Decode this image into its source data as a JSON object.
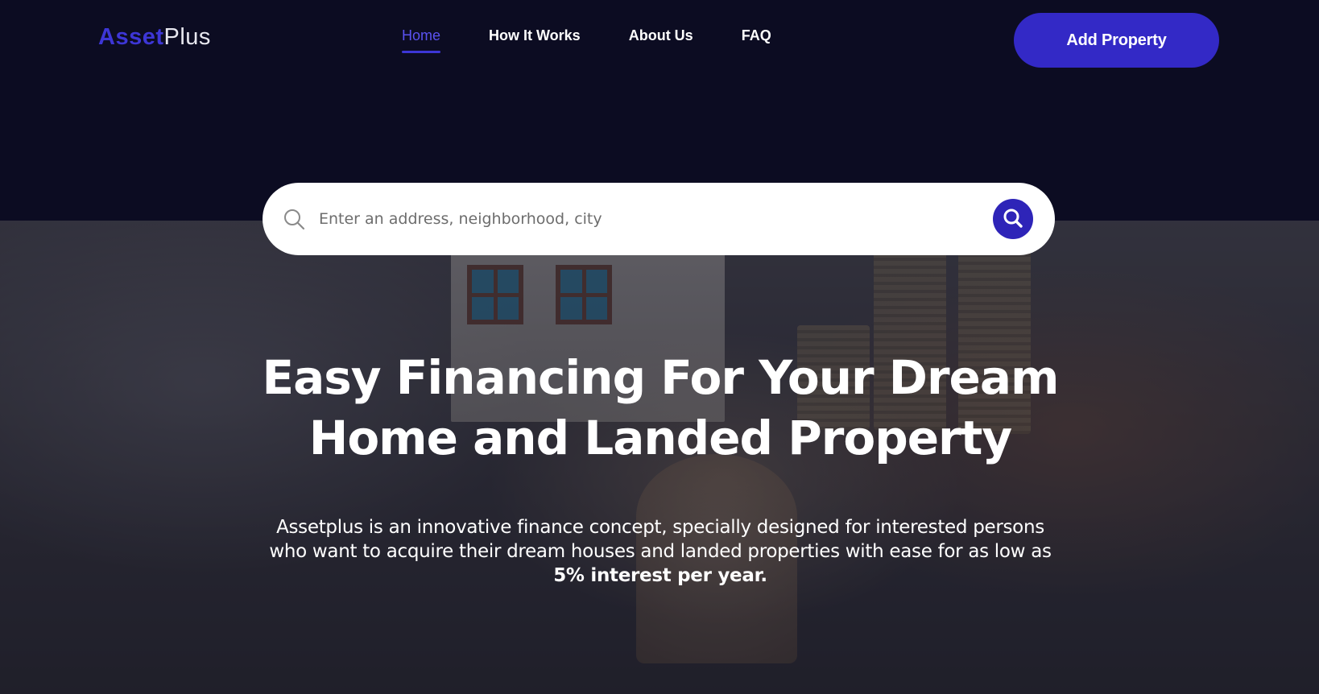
{
  "header": {
    "logo_part1": "Asset",
    "logo_part2": "Plus",
    "nav": [
      {
        "label": "Home",
        "active": true
      },
      {
        "label": "How It Works",
        "active": false
      },
      {
        "label": "About Us",
        "active": false
      },
      {
        "label": "FAQ",
        "active": false
      }
    ],
    "cta_label": "Add Property"
  },
  "search": {
    "placeholder": "Enter an address, neighborhood, city",
    "value": ""
  },
  "hero": {
    "headline_line1": "Easy Financing For Your Dream",
    "headline_line2": "Home and Landed Property",
    "description": "Assetplus is an innovative finance concept, specially designed for interested persons who want to acquire their dream houses and landed properties with ease for as low as",
    "description_highlight": "5% interest per year."
  },
  "colors": {
    "background": "#0c0c22",
    "accent": "#3329c6",
    "accent_active": "#5a52f0",
    "text": "#ffffff"
  },
  "icons": {
    "search_field_icon": "magnifier-icon",
    "search_button_icon": "search-icon"
  }
}
